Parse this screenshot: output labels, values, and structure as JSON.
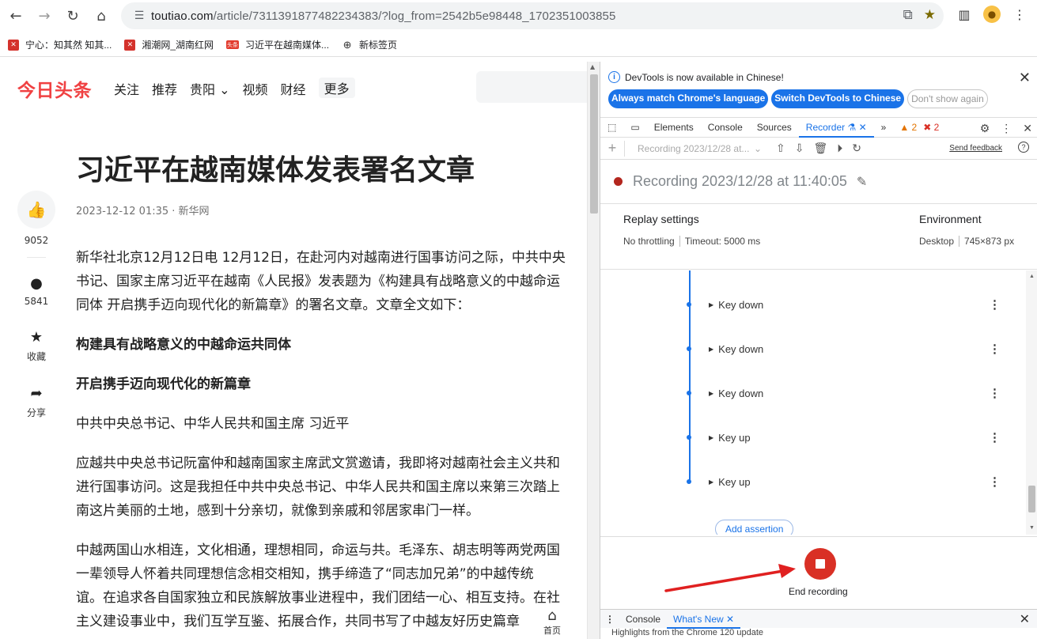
{
  "browser": {
    "url_host": "toutiao.com",
    "url_path": "/article/7311391877482234383/?log_from=2542b5e98448_1702351003855",
    "bookmarks": [
      {
        "label": "宁心：知其然 知其..."
      },
      {
        "label": "湘潮网_湖南红网"
      },
      {
        "label": "习近平在越南媒体..."
      },
      {
        "label": "新标签页"
      }
    ],
    "bookmark_badge": "头条"
  },
  "site": {
    "logo": "今日头条",
    "nav": [
      "关注",
      "推荐",
      "贵阳 ⌄",
      "视频",
      "财经"
    ],
    "nav_more": "更多",
    "home_float": "首页"
  },
  "article": {
    "title": "习近平在越南媒体发表署名文章",
    "meta": "2023-12-12 01:35 · 新华网",
    "like_count": "9052",
    "comment_count": "5841",
    "favorite_label": "收藏",
    "share_label": "分享",
    "paragraphs": [
      "新华社北京12月12日电 12月12日，在赴河内对越南进行国事访问之际，中共中央\n书记、国家主席习近平在越南《人民报》发表题为《构建具有战略意义的中越命运\n同体 开启携手迈向现代化的新篇章》的署名文章。文章全文如下：",
      "构建具有战略意义的中越命运共同体",
      "开启携手迈向现代化的新篇章",
      "中共中央总书记、中华人民共和国主席 习近平",
      "应越共中央总书记阮富仲和越南国家主席武文赏邀请，我即将对越南社会主义共和\n进行国事访问。这是我担任中共中央总书记、中华人民共和国主席以来第三次踏上\n南这片美丽的土地，感到十分亲切，就像到亲戚和邻居家串门一样。",
      "中越两国山水相连，文化相通，理想相同，命运与共。毛泽东、胡志明等两党两国\n一辈领导人怀着共同理想信念相交相知，携手缔造了“同志加兄弟”的中越传统\n谊。在追求各自国家独立和民族解放事业进程中，我们团结一心、相互支持。在社\n主义建设事业中，我们互学互鉴、拓展合作，共同书写了中越友好历史篇章"
    ]
  },
  "devtools": {
    "info_message": "DevTools is now available in Chinese!",
    "btn_match": "Always match Chrome's language",
    "btn_switch": "Switch DevTools to Chinese",
    "btn_dont_show": "Don't show again",
    "tabs": [
      "Elements",
      "Console",
      "Sources"
    ],
    "active_tab": "Recorder",
    "warn_count": "2",
    "error_count": "2",
    "recording_select": "Recording 2023/12/28 at...",
    "send_feedback": "Send feedback",
    "recording_title": "Recording 2023/12/28 at 11:40:05",
    "replay_settings_label": "Replay settings",
    "throttling": "No throttling",
    "timeout": "Timeout: 5000 ms",
    "environment_label": "Environment",
    "env_device": "Desktop",
    "env_size": "745×873 px",
    "steps": [
      {
        "label": "Key down"
      },
      {
        "label": "Key down"
      },
      {
        "label": "Key down"
      },
      {
        "label": "Key up"
      },
      {
        "label": "Key up"
      }
    ],
    "add_assertion": "Add assertion",
    "end_recording": "End recording",
    "drawer_tabs": [
      "Console",
      "What's New"
    ],
    "drawer_text": "Highlights from the Chrome 120 update"
  },
  "colors": {
    "accent_blue": "#1a73e8",
    "record_red": "#d93025",
    "brand_red": "#f04142",
    "annotation_arrow": "#e02020"
  }
}
